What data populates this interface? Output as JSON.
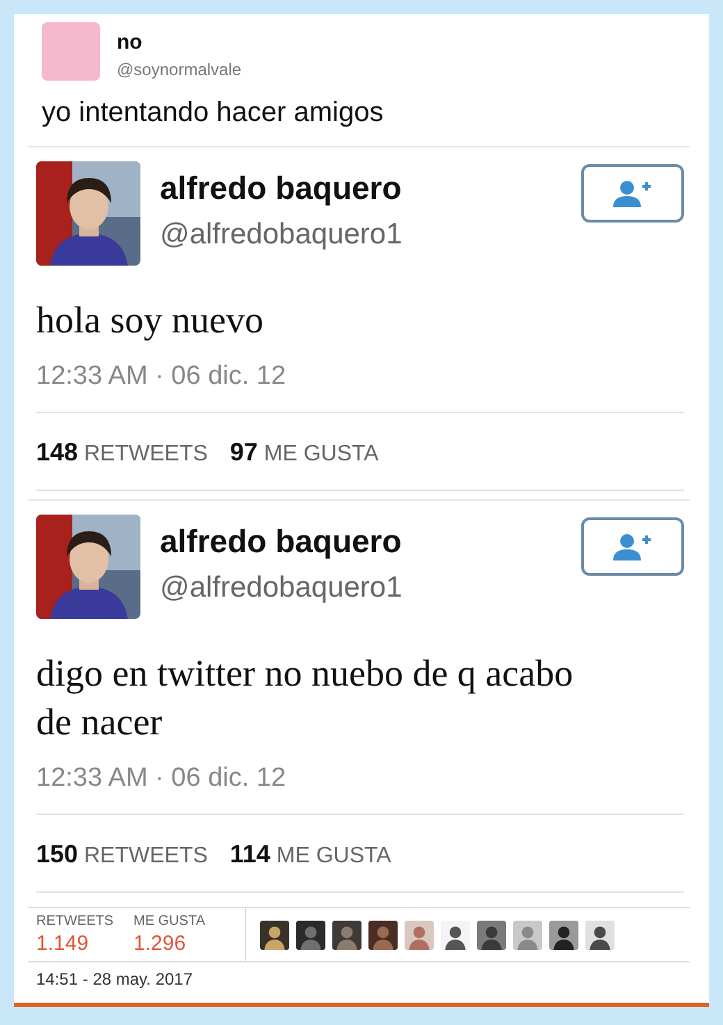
{
  "header": {
    "name": "no",
    "handle": "@soynormalvale",
    "text": "yo intentando hacer amigos"
  },
  "tweets": [
    {
      "name": "alfredo baquero",
      "handle": "@alfredobaquero1",
      "text": "hola soy nuevo",
      "time": "12:33 AM · 06 dic. 12",
      "retweets": "148",
      "retweets_label": "RETWEETS",
      "likes": "97",
      "likes_label": "ME GUSTA"
    },
    {
      "name": "alfredo baquero",
      "handle": "@alfredobaquero1",
      "text": "digo en twitter no nuebo de q acabo de nacer",
      "time": "12:33 AM · 06 dic. 12",
      "retweets": "150",
      "retweets_label": "RETWEETS",
      "likes": "114",
      "likes_label": "ME GUSTA"
    }
  ],
  "footer": {
    "retweets_label": "RETWEETS",
    "retweets": "1.149",
    "likes_label": "ME GUSTA",
    "likes": "1.296",
    "date": "14:51 - 28 may. 2017"
  }
}
